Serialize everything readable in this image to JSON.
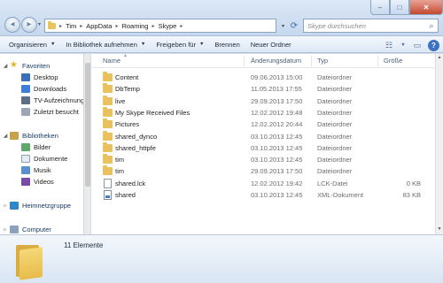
{
  "address": {
    "crumbs": [
      "Tim",
      "AppData",
      "Roaming",
      "Skype"
    ]
  },
  "search": {
    "placeholder": "Skype durchsuchen"
  },
  "window_controls": {
    "minimize": "–",
    "maximize": "□",
    "close": "✕"
  },
  "toolbar": {
    "organize": "Organisieren",
    "include_library": "In Bibliothek aufnehmen",
    "share": "Freigeben für",
    "burn": "Brennen",
    "new_folder": "Neuer Ordner"
  },
  "nav": {
    "favorites": "Favoriten",
    "desktop": "Desktop",
    "downloads": "Downloads",
    "tv": "TV-Aufzeichnung",
    "recent": "Zuletzt besucht",
    "libraries": "Bibliotheken",
    "pictures": "Bilder",
    "documents": "Dokumente",
    "music": "Musik",
    "videos": "Videos",
    "homegroup": "Heimnetzgruppe",
    "computer": "Computer"
  },
  "columns": {
    "name": "Name",
    "date": "Änderungsdatum",
    "type": "Typ",
    "size": "Größe"
  },
  "files": [
    {
      "name": "Content",
      "date": "09.06.2013 15:00",
      "type": "Dateiordner",
      "size": "",
      "kind": "folder"
    },
    {
      "name": "DbTemp",
      "date": "11.05.2013 17:55",
      "type": "Dateiordner",
      "size": "",
      "kind": "folder"
    },
    {
      "name": "live",
      "date": "29.09.2013 17:50",
      "type": "Dateiordner",
      "size": "",
      "kind": "folder"
    },
    {
      "name": "My Skype Received Files",
      "date": "12.02.2012 19:48",
      "type": "Dateiordner",
      "size": "",
      "kind": "folder"
    },
    {
      "name": "Pictures",
      "date": "12.02.2012 20:44",
      "type": "Dateiordner",
      "size": "",
      "kind": "folder"
    },
    {
      "name": "shared_dynco",
      "date": "03.10.2013 12:45",
      "type": "Dateiordner",
      "size": "",
      "kind": "folder"
    },
    {
      "name": "shared_httpfe",
      "date": "03.10.2013 12:45",
      "type": "Dateiordner",
      "size": "",
      "kind": "folder"
    },
    {
      "name": "tim",
      "date": "03.10.2013 12:45",
      "type": "Dateiordner",
      "size": "",
      "kind": "folder"
    },
    {
      "name": "tim",
      "date": "29.09.2013 17:50",
      "type": "Dateiordner",
      "size": "",
      "kind": "folder"
    },
    {
      "name": "shared.lck",
      "date": "12.02.2012 19:42",
      "type": "LCK-Datei",
      "size": "0 KB",
      "kind": "file"
    },
    {
      "name": "shared",
      "date": "03.10.2013 12:45",
      "type": "XML-Dokument",
      "size": "83 KB",
      "kind": "xml"
    }
  ],
  "details": {
    "count": "11 Elemente"
  }
}
